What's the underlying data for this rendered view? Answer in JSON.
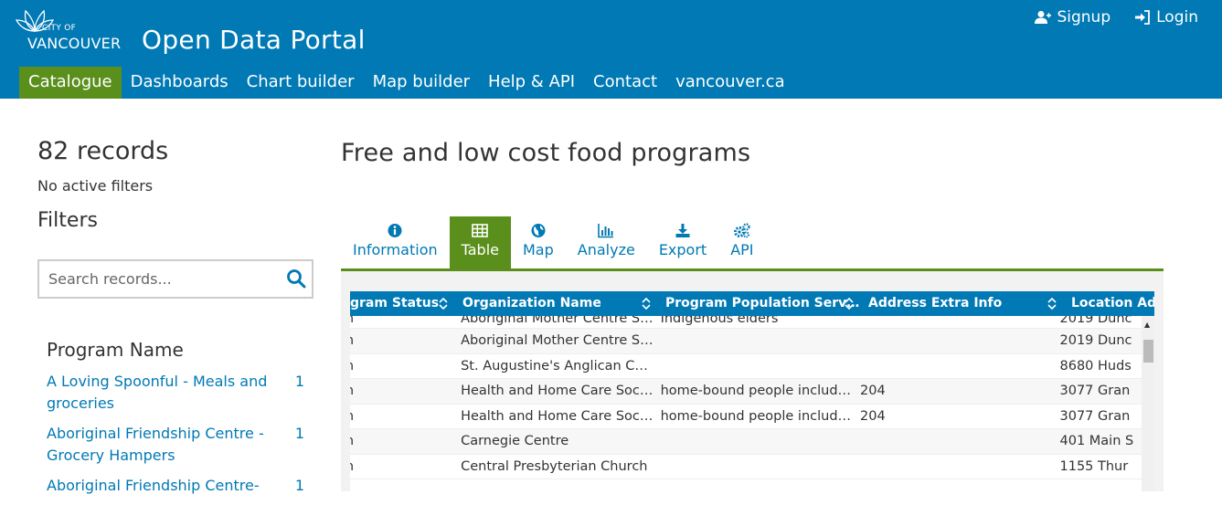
{
  "header": {
    "logo_city": "CITY OF",
    "logo_vancouver": "VANCOUVER",
    "portal_title": "Open Data Portal",
    "signup_label": "Signup",
    "login_label": "Login",
    "brand_color": "#0079b4",
    "active_color": "#5a8f1c"
  },
  "nav": {
    "items": [
      {
        "label": "Catalogue",
        "active": true
      },
      {
        "label": "Dashboards"
      },
      {
        "label": "Chart builder"
      },
      {
        "label": "Map builder"
      },
      {
        "label": "Help & API"
      },
      {
        "label": "Contact"
      },
      {
        "label": "vancouver.ca"
      }
    ]
  },
  "sidebar": {
    "records_count": "82 records",
    "no_filters": "No active filters",
    "filters_title": "Filters",
    "search_placeholder": "Search records...",
    "facet_title": "Program Name",
    "facets": [
      {
        "label": "A Loving Spoonful - Meals and groceries",
        "count": "1"
      },
      {
        "label": "Aboriginal Friendship Centre - Grocery Hampers",
        "count": "1"
      },
      {
        "label": "Aboriginal Friendship Centre-",
        "count": "1"
      }
    ]
  },
  "main": {
    "title": "Free and low cost food programs",
    "tabs": [
      {
        "label": "Information",
        "icon": "info-circle-icon"
      },
      {
        "label": "Table",
        "icon": "table-icon",
        "active": true
      },
      {
        "label": "Map",
        "icon": "globe-icon"
      },
      {
        "label": "Analyze",
        "icon": "bar-chart-icon"
      },
      {
        "label": "Export",
        "icon": "download-icon"
      },
      {
        "label": "API",
        "icon": "gears-icon"
      }
    ]
  },
  "table": {
    "columns": [
      "Program Status",
      "Organization Name",
      "Program Population Served",
      "Address Extra Info",
      "Location Address"
    ],
    "column_display": [
      "gram Status",
      "Organization Name",
      "Program Population Serv…",
      "Address Extra Info",
      "Location Add"
    ],
    "rows": [
      [
        "en",
        "Aboriginal Mother Centre S…",
        "Indigenous elders",
        "",
        "2019 Dunc"
      ],
      [
        "en",
        "Aboriginal Mother Centre S…",
        "",
        "",
        "2019 Dunc"
      ],
      [
        "en",
        "St. Augustine's Anglican Ch…",
        "",
        "",
        "8680 Huds"
      ],
      [
        "en",
        "Health and Home Care Soci…",
        "home-bound people includ…",
        "204",
        "3077 Gran"
      ],
      [
        "en",
        "Health and Home Care Soci…",
        "home-bound people includ…",
        "204",
        "3077 Gran"
      ],
      [
        "en",
        "Carnegie Centre",
        "",
        "",
        "401 Main S"
      ],
      [
        "en",
        "Central Presbyterian Church",
        "",
        "",
        "1155 Thur"
      ]
    ]
  }
}
